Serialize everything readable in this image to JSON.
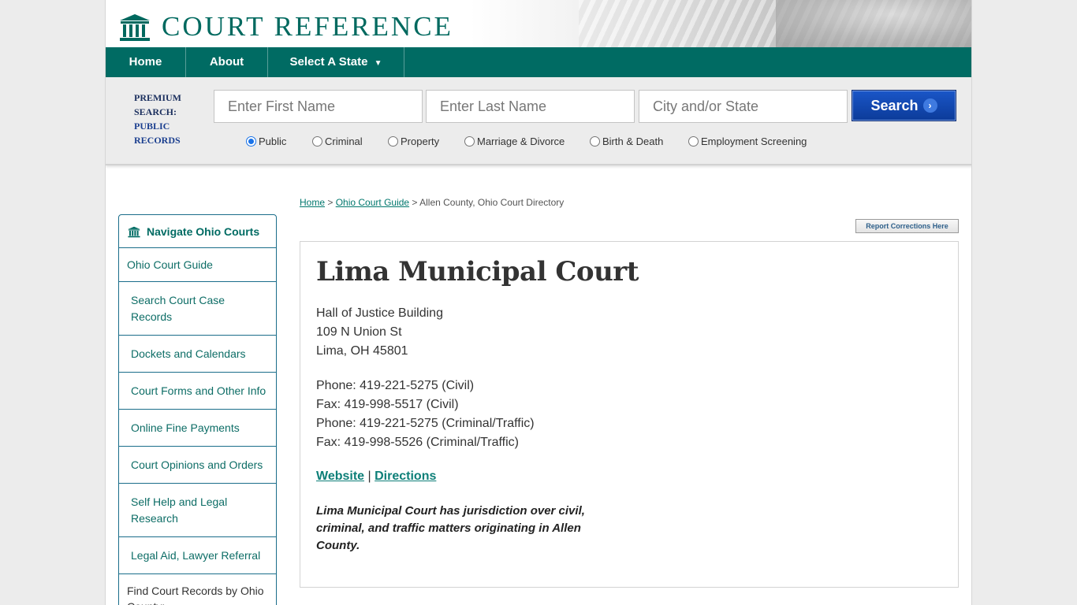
{
  "brand": {
    "name": "COURT REFERENCE",
    "logo_icon": "courthouse-icon",
    "primary_color": "#006b63"
  },
  "nav": {
    "home": "Home",
    "about": "About",
    "select_state": "Select A State",
    "select_state_icon": "caret-down-icon"
  },
  "search": {
    "premium_line1": "PREMIUM",
    "premium_line2": "SEARCH:",
    "public_line1": "PUBLIC",
    "public_line2": "RECORDS",
    "first_name_placeholder": "Enter First Name",
    "last_name_placeholder": "Enter Last Name",
    "city_state_placeholder": "City and/or State",
    "button_label": "Search",
    "button_icon": "chevron-right-icon",
    "record_types": [
      "Public",
      "Criminal",
      "Property",
      "Marriage & Divorce",
      "Birth & Death",
      "Employment Screening"
    ],
    "selected_type": "Public"
  },
  "breadcrumb": {
    "home": "Home",
    "guide": "Ohio Court Guide",
    "current": "Allen County, Ohio Court Directory",
    "sep": " > "
  },
  "report_button": "Report Corrections Here",
  "sidebar": {
    "title": "Navigate Ohio Courts",
    "icon": "courthouse-icon",
    "items": [
      "Ohio Court Guide",
      "Search Court Case Records",
      "Dockets and Calendars",
      "Court Forms and Other Info",
      "Online Fine Payments",
      "Court Opinions and Orders",
      "Self Help and Legal Research",
      "Legal Aid, Lawyer Referral"
    ],
    "footer_text": "Find Court Records by Ohio County:"
  },
  "court": {
    "name": "Lima Municipal Court",
    "address_lines": [
      "Hall of Justice Building",
      "109 N Union St",
      "Lima, OH 45801"
    ],
    "contact_lines": [
      "Phone: 419-221-5275 (Civil)",
      "Fax: 419-998-5517 (Civil)",
      "Phone: 419-221-5275 (Criminal/Traffic)",
      "Fax: 419-998-5526 (Criminal/Traffic)"
    ],
    "website_label": "Website",
    "link_sep": "|",
    "directions_label": "Directions",
    "description": "Lima Municipal Court has jurisdiction over civil, criminal, and traffic matters originating in Allen County."
  }
}
